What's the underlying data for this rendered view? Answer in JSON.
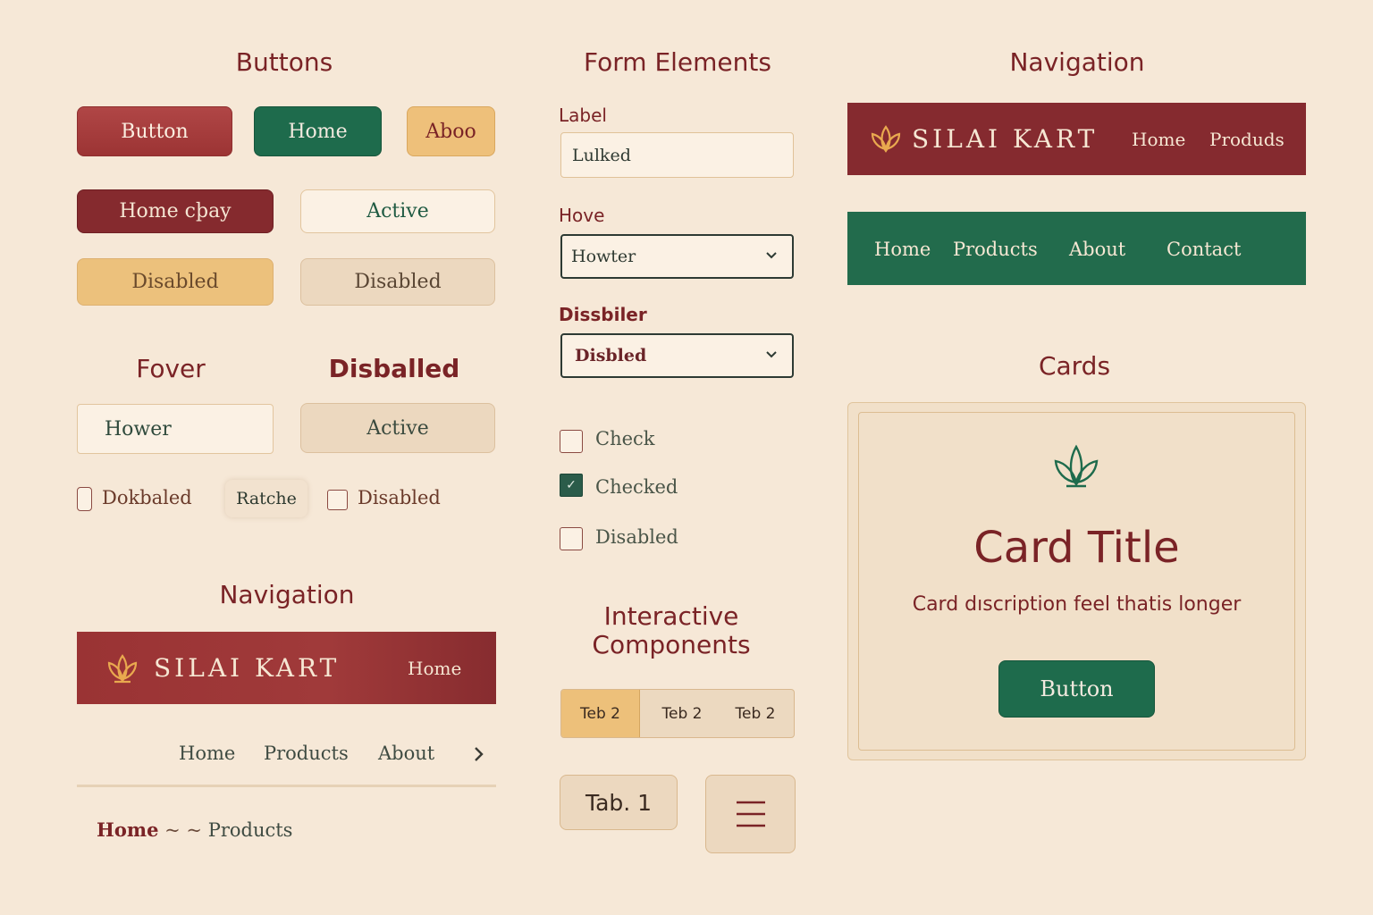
{
  "sections": {
    "buttons_title": "Buttons",
    "forms_title": "Form Elements",
    "navigation_title": "Navigation",
    "cards_title": "Cards",
    "hover_title": "Fover",
    "disabled_title": "Disballed",
    "navigation_title_2": "Navigation",
    "interactive_title_line1": "Interactive",
    "interactive_title_line2": "Components"
  },
  "buttons": {
    "primary": "Button",
    "home": "Home",
    "about": "Aboo",
    "home_play": "Home cþay",
    "active": "Active",
    "disabled_gold": "Disabled",
    "disabled_beige": "Disabled",
    "hover": "Hower",
    "active_2": "Active"
  },
  "checkbox_row": [
    {
      "label": "Dokbaled"
    },
    {
      "label": "Ratche"
    },
    {
      "label": "Disabled"
    }
  ],
  "form": {
    "label_1": "Label",
    "input_1_value": "Lulked",
    "label_2": "Hove",
    "select_1_value": "Howter",
    "label_3": "Dissbiler",
    "select_2_value": "Disbled",
    "checkboxes": [
      {
        "label": "Check",
        "checked": false
      },
      {
        "label": "Checked",
        "checked": true
      },
      {
        "label": "Disabled",
        "checked": false
      }
    ]
  },
  "tabs": [
    "Teb 2",
    "Teb 2",
    "Teb 2"
  ],
  "tab_single": "Tab. 1",
  "nav_top_red": {
    "brand": "SILAI KART",
    "links": [
      "Home",
      "Produds"
    ]
  },
  "nav_green": {
    "links": [
      "Home",
      "Products",
      "About",
      "Contact"
    ]
  },
  "nav_bottom_red": {
    "brand": "SILAI KART",
    "link": "Home"
  },
  "nav_plain": {
    "links": [
      "Home",
      "Products",
      "About"
    ]
  },
  "breadcrumb": {
    "home": "Home",
    "separator": "~ ~",
    "current": "Products"
  },
  "card": {
    "title": "Card Title",
    "description": "Card dıscription feel thatis longer",
    "button": "Button"
  },
  "icons": [
    "lotus-icon",
    "chevron-down-icon",
    "chevron-right-icon",
    "hamburger-menu-icon"
  ],
  "colors": {
    "background": "#f6e8d7",
    "maroon": "#7a2326",
    "green": "#1e6b4c",
    "gold": "#eec07a",
    "beige": "#ecd8bf"
  }
}
